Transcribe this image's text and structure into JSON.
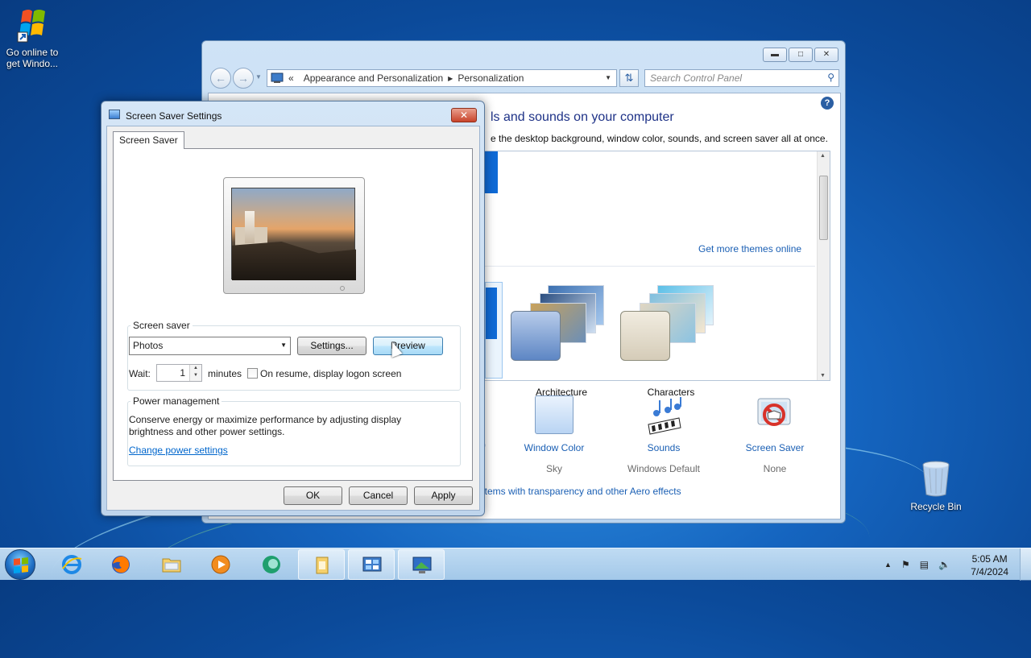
{
  "desktop": {
    "icons": [
      {
        "label": "Go online to get Windo..."
      },
      {
        "label": "Recycle Bin"
      }
    ]
  },
  "control_panel": {
    "address": {
      "prefix": "«",
      "crumbs": [
        "Appearance and Personalization",
        "Personalization"
      ]
    },
    "search_placeholder": "Search Control Panel",
    "heading": "ls and sounds on your computer",
    "subheading": "e the desktop background, window color, sounds, and screen saver all at once.",
    "get_more_themes": "Get more themes online",
    "themes": [
      {
        "label": "Architecture"
      },
      {
        "label": "Characters"
      }
    ],
    "bottom_items": [
      {
        "label": "Window Color",
        "value": "Sky"
      },
      {
        "label": "Sounds",
        "value": "Windows Default"
      },
      {
        "label": "Screen Saver",
        "value": "None"
      }
    ],
    "aero_link": "items with transparency and other Aero effects"
  },
  "screen_saver_dialog": {
    "title": "Screen Saver Settings",
    "tab": "Screen Saver",
    "screen_saver_group": "Screen saver",
    "selected_saver": "Photos",
    "settings_button": "Settings...",
    "preview_button": "Preview",
    "wait_label": "Wait:",
    "wait_value": "1",
    "minutes_label": "minutes",
    "resume_checkbox_label": "On resume, display logon screen",
    "resume_checked": false,
    "power_group": "Power management",
    "power_text": "Conserve energy or maximize performance by adjusting display brightness and other power settings.",
    "power_link": "Change power settings",
    "ok_button": "OK",
    "cancel_button": "Cancel",
    "apply_button": "Apply"
  },
  "taskbar": {
    "apps": [
      "start-button",
      "internet-explorer",
      "firefox",
      "file-explorer",
      "media-player",
      "app-chat",
      "running-folder",
      "running-control-panel",
      "running-screensaver"
    ],
    "clock_time": "5:05 AM",
    "clock_date": "7/4/2024"
  },
  "colors": {
    "accent_link": "#1a5fb4",
    "heading": "#1e3287",
    "close_button": "#c8432a"
  }
}
